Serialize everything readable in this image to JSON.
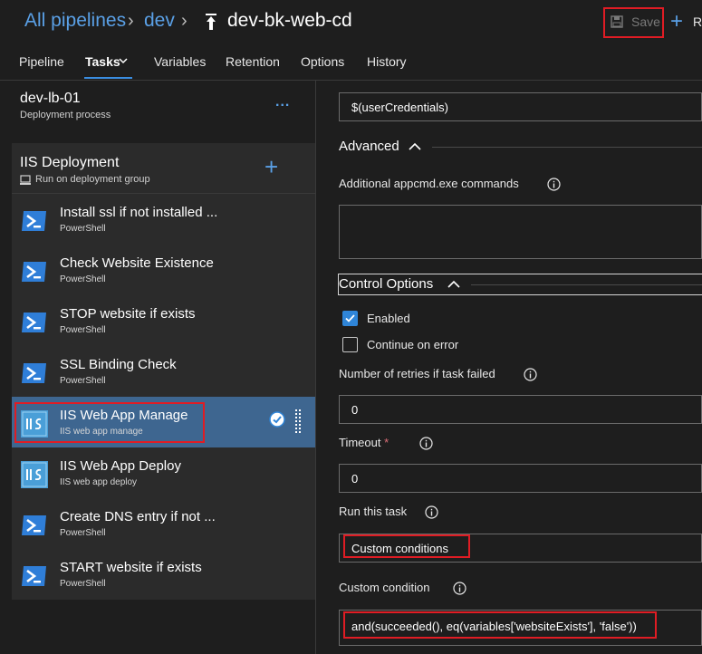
{
  "breadcrumb": {
    "root": "All pipelines",
    "folder": "dev",
    "pipeline_name": "dev-bk-web-cd"
  },
  "toolbar": {
    "save_label": "Save",
    "release_label": "R"
  },
  "tabs": [
    {
      "label": "Pipeline"
    },
    {
      "label": "Tasks"
    },
    {
      "label": "Variables"
    },
    {
      "label": "Retention"
    },
    {
      "label": "Options"
    },
    {
      "label": "History"
    }
  ],
  "stage": {
    "name": "dev-lb-01",
    "subtitle": "Deployment process",
    "menu_glyph": "..."
  },
  "phase": {
    "name": "IIS Deployment",
    "subtitle": "Run on deployment group"
  },
  "tasks": [
    {
      "title": "Install ssl if not installed ...",
      "type": "PowerShell",
      "icon": "powershell-icon"
    },
    {
      "title": "Check Website Existence",
      "type": "PowerShell",
      "icon": "powershell-icon"
    },
    {
      "title": "STOP website if exists",
      "type": "PowerShell",
      "icon": "powershell-icon"
    },
    {
      "title": "SSL Binding Check",
      "type": "PowerShell",
      "icon": "powershell-icon"
    },
    {
      "title": "IIS Web App Manage",
      "type": "IIS web app manage",
      "icon": "iis-icon"
    },
    {
      "title": "IIS Web App Deploy",
      "type": "IIS web app deploy",
      "icon": "iis-icon"
    },
    {
      "title": "Create DNS entry if not ...",
      "type": "PowerShell",
      "icon": "powershell-icon"
    },
    {
      "title": "START website if exists",
      "type": "PowerShell",
      "icon": "powershell-icon"
    }
  ],
  "selected_task_index": 4,
  "details": {
    "credentials_value": "$(userCredentials)",
    "advanced_title": "Advanced",
    "appcmd_label": "Additional appcmd.exe commands",
    "appcmd_value": "",
    "control_options_title": "Control Options",
    "enabled_label": "Enabled",
    "enabled_checked": true,
    "continue_on_error_label": "Continue on error",
    "continue_on_error_checked": false,
    "retries_label": "Number of retries if task failed",
    "retries_value": "0",
    "timeout_label": "Timeout",
    "timeout_required_marker": "*",
    "timeout_value": "0",
    "run_task_label": "Run this task",
    "run_task_value": "Custom conditions",
    "custom_condition_label": "Custom condition",
    "custom_condition_value": "and(succeeded(), eq(variables['websiteExists'], 'false'))"
  },
  "colors": {
    "accent": "#5aa0e6",
    "selected_row": "#3e6690",
    "highlight_border": "#e01c24",
    "checkbox_checked": "#2f85d8"
  }
}
